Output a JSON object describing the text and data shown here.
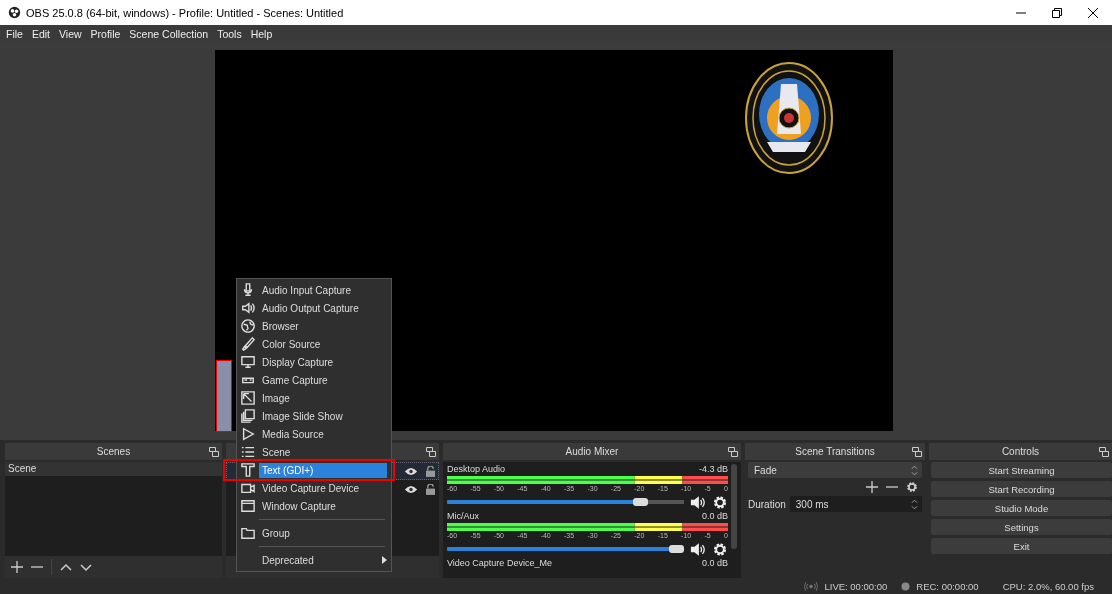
{
  "window": {
    "title": "OBS 25.0.8 (64-bit, windows) - Profile: Untitled - Scenes: Untitled"
  },
  "menu_bar": [
    "File",
    "Edit",
    "View",
    "Profile",
    "Scene Collection",
    "Tools",
    "Help"
  ],
  "scenes": {
    "title": "Scenes",
    "items": [
      {
        "label": "Scene",
        "selected": true
      }
    ]
  },
  "sources": {
    "items": [
      {
        "selected": true
      },
      {
        "selected": false
      }
    ]
  },
  "context_menu": [
    {
      "kind": "item",
      "label": "Audio Input Capture",
      "selected": false
    },
    {
      "kind": "item",
      "label": "Audio Output Capture",
      "selected": false
    },
    {
      "kind": "item",
      "label": "Browser",
      "selected": false
    },
    {
      "kind": "item",
      "label": "Color Source",
      "selected": false
    },
    {
      "kind": "item",
      "label": "Display Capture",
      "selected": false
    },
    {
      "kind": "item",
      "label": "Game Capture",
      "selected": false
    },
    {
      "kind": "item",
      "label": "Image",
      "selected": false
    },
    {
      "kind": "item",
      "label": "Image Slide Show",
      "selected": false
    },
    {
      "kind": "item",
      "label": "Media Source",
      "selected": false
    },
    {
      "kind": "item",
      "label": "Scene",
      "selected": false
    },
    {
      "kind": "item",
      "label": "Text (GDI+)",
      "selected": true
    },
    {
      "kind": "item",
      "label": "Video Capture Device",
      "selected": false
    },
    {
      "kind": "item",
      "label": "Window Capture",
      "selected": false
    },
    {
      "kind": "separator"
    },
    {
      "kind": "item",
      "label": "Group",
      "selected": false
    },
    {
      "kind": "separator"
    },
    {
      "kind": "submenu",
      "label": "Deprecated",
      "selected": false
    }
  ],
  "audio_mixer": {
    "title": "Audio Mixer",
    "channels": [
      {
        "name": "Desktop Audio",
        "reading": "-4.3 dB",
        "level": 0.85,
        "scale": [
          "-60",
          "-55",
          "-50",
          "-45",
          "-40",
          "-35",
          "-30",
          "-25",
          "-20",
          "-15",
          "-10",
          "-5",
          "0"
        ]
      },
      {
        "name": "Mic/Aux",
        "reading": "0.0 dB",
        "level": 1.0,
        "scale": [
          "-60",
          "-55",
          "-50",
          "-45",
          "-40",
          "-35",
          "-30",
          "-25",
          "-20",
          "-15",
          "-10",
          "-5",
          "0"
        ]
      },
      {
        "name": "Video Capture Device_Me",
        "reading": "0.0 dB"
      }
    ]
  },
  "scene_transitions": {
    "title": "Scene Transitions",
    "transition": "Fade",
    "duration_label": "Duration",
    "duration": "300 ms"
  },
  "controls": {
    "title": "Controls",
    "buttons": [
      "Start Streaming",
      "Start Recording",
      "Studio Mode",
      "Settings",
      "Exit"
    ]
  },
  "status_bar": {
    "live": "LIVE: 00:00:00",
    "rec": "REC: 00:00:00",
    "cpu": "CPU: 2.0%, 60.00 fps"
  }
}
